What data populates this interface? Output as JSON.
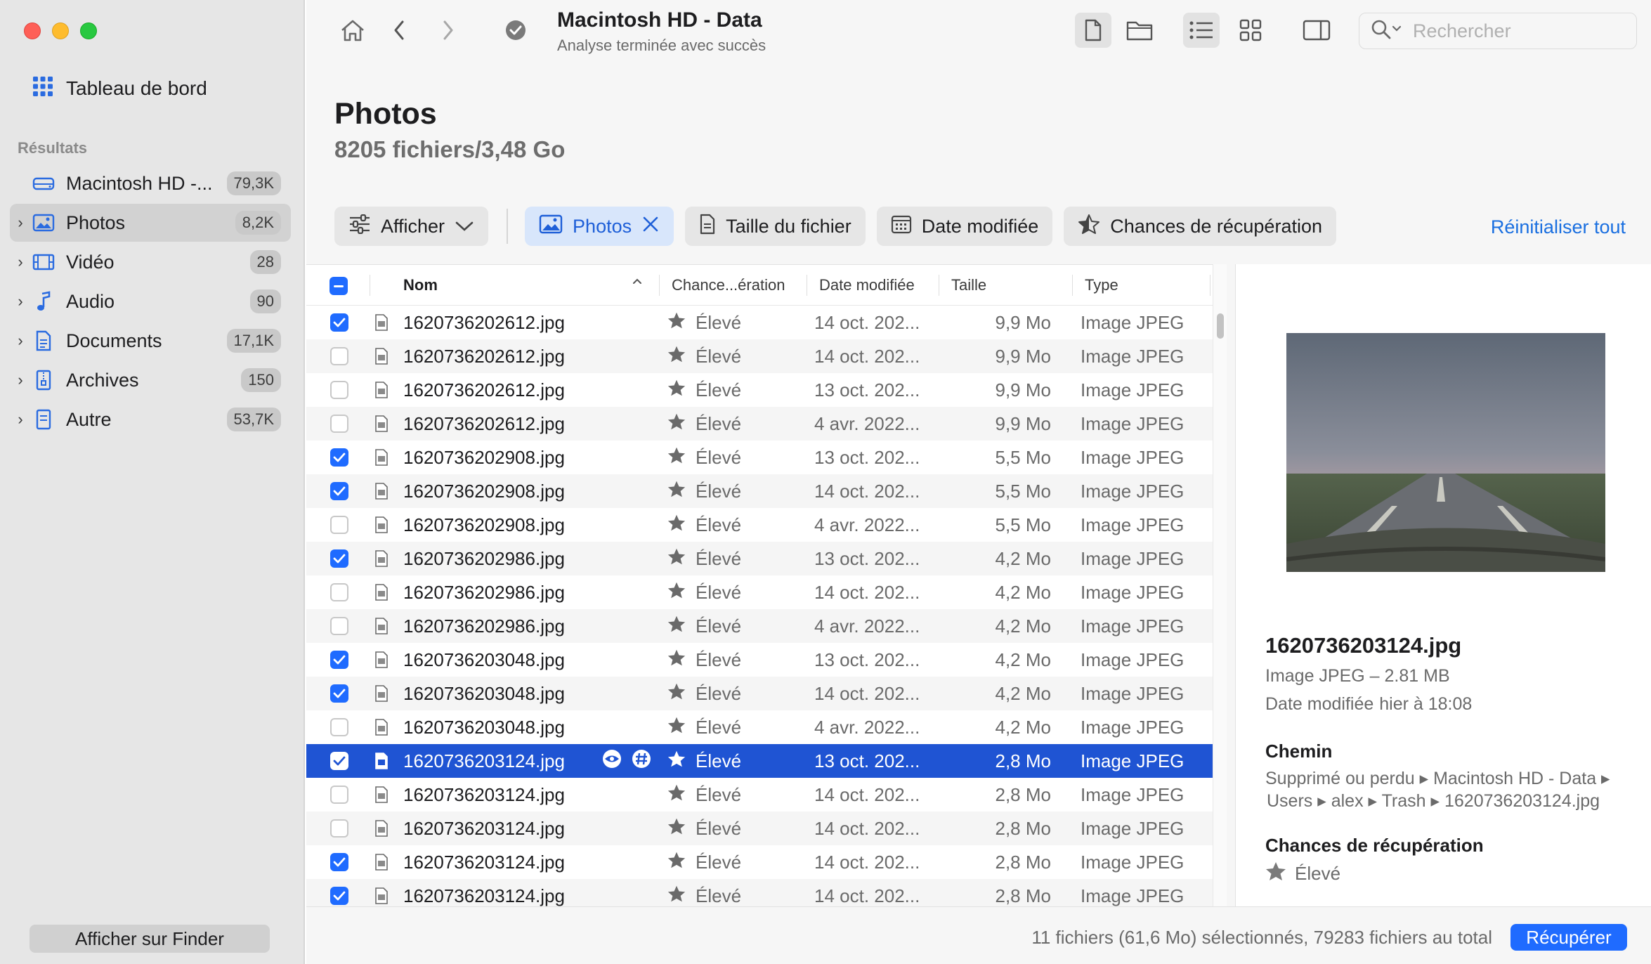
{
  "window": {
    "title": "Macintosh HD - Data",
    "subtitle": "Analyse terminée avec succès"
  },
  "search": {
    "placeholder": "Rechercher"
  },
  "sidebar": {
    "dashboard": "Tableau de bord",
    "section": "Résultats",
    "items": [
      {
        "label": "Macintosh HD -...",
        "count": "79,3K",
        "icon": "drive-icon"
      },
      {
        "label": "Photos",
        "count": "8,2K",
        "icon": "photo-icon"
      },
      {
        "label": "Vidéo",
        "count": "28",
        "icon": "film-icon"
      },
      {
        "label": "Audio",
        "count": "90",
        "icon": "music-note-icon"
      },
      {
        "label": "Documents",
        "count": "17,1K",
        "icon": "document-icon"
      },
      {
        "label": "Archives",
        "count": "150",
        "icon": "archive-icon"
      },
      {
        "label": "Autre",
        "count": "53,7K",
        "icon": "other-file-icon"
      }
    ],
    "finder_button": "Afficher sur Finder"
  },
  "page": {
    "title": "Photos",
    "subtitle": "8205 fichiers/3,48 Go"
  },
  "filters": {
    "show": "Afficher",
    "photos": "Photos",
    "file_size": "Taille du fichier",
    "date_modified": "Date modifiée",
    "recovery_chances": "Chances de récupération",
    "reset_all": "Réinitialiser tout"
  },
  "table": {
    "columns": {
      "name": "Nom",
      "chance": "Chance...ération",
      "date": "Date modifiée",
      "size": "Taille",
      "type": "Type"
    },
    "rows": [
      {
        "checked": true,
        "name": "1620736202612.jpg",
        "chance": "Élevé",
        "date": "14 oct. 202...",
        "size": "9,9 Mo",
        "type": "Image JPEG"
      },
      {
        "checked": false,
        "name": "1620736202612.jpg",
        "chance": "Élevé",
        "date": "14 oct. 202...",
        "size": "9,9 Mo",
        "type": "Image JPEG"
      },
      {
        "checked": false,
        "name": "1620736202612.jpg",
        "chance": "Élevé",
        "date": "13 oct. 202...",
        "size": "9,9 Mo",
        "type": "Image JPEG"
      },
      {
        "checked": false,
        "name": "1620736202612.jpg",
        "chance": "Élevé",
        "date": "4 avr. 2022...",
        "size": "9,9 Mo",
        "type": "Image JPEG"
      },
      {
        "checked": true,
        "name": "1620736202908.jpg",
        "chance": "Élevé",
        "date": "13 oct. 202...",
        "size": "5,5 Mo",
        "type": "Image JPEG"
      },
      {
        "checked": true,
        "name": "1620736202908.jpg",
        "chance": "Élevé",
        "date": "14 oct. 202...",
        "size": "5,5 Mo",
        "type": "Image JPEG"
      },
      {
        "checked": false,
        "name": "1620736202908.jpg",
        "chance": "Élevé",
        "date": "4 avr. 2022...",
        "size": "5,5 Mo",
        "type": "Image JPEG"
      },
      {
        "checked": true,
        "name": "1620736202986.jpg",
        "chance": "Élevé",
        "date": "13 oct. 202...",
        "size": "4,2 Mo",
        "type": "Image JPEG"
      },
      {
        "checked": false,
        "name": "1620736202986.jpg",
        "chance": "Élevé",
        "date": "14 oct. 202...",
        "size": "4,2 Mo",
        "type": "Image JPEG"
      },
      {
        "checked": false,
        "name": "1620736202986.jpg",
        "chance": "Élevé",
        "date": "4 avr. 2022...",
        "size": "4,2 Mo",
        "type": "Image JPEG"
      },
      {
        "checked": true,
        "name": "1620736203048.jpg",
        "chance": "Élevé",
        "date": "13 oct. 202...",
        "size": "4,2 Mo",
        "type": "Image JPEG"
      },
      {
        "checked": true,
        "name": "1620736203048.jpg",
        "chance": "Élevé",
        "date": "14 oct. 202...",
        "size": "4,2 Mo",
        "type": "Image JPEG"
      },
      {
        "checked": false,
        "name": "1620736203048.jpg",
        "chance": "Élevé",
        "date": "4 avr. 2022...",
        "size": "4,2 Mo",
        "type": "Image JPEG"
      },
      {
        "checked": true,
        "name": "1620736203124.jpg",
        "chance": "Élevé",
        "date": "13 oct. 202...",
        "size": "2,8 Mo",
        "type": "Image JPEG",
        "selected": true
      },
      {
        "checked": false,
        "name": "1620736203124.jpg",
        "chance": "Élevé",
        "date": "14 oct. 202...",
        "size": "2,8 Mo",
        "type": "Image JPEG"
      },
      {
        "checked": false,
        "name": "1620736203124.jpg",
        "chance": "Élevé",
        "date": "14 oct. 202...",
        "size": "2,8 Mo",
        "type": "Image JPEG"
      },
      {
        "checked": true,
        "name": "1620736203124.jpg",
        "chance": "Élevé",
        "date": "14 oct. 202...",
        "size": "2,8 Mo",
        "type": "Image JPEG"
      },
      {
        "checked": true,
        "name": "1620736203124.jpg",
        "chance": "Élevé",
        "date": "14 oct. 202...",
        "size": "2,8 Mo",
        "type": "Image JPEG"
      }
    ]
  },
  "preview": {
    "filename": "1620736203124.jpg",
    "type_size": "Image JPEG – 2.81 MB",
    "date_label": "Date modifiée",
    "date_value": "hier à 18:08",
    "path_heading": "Chemin",
    "path_line1": "Supprimé ou perdu ▸ Macintosh HD - Data ▸",
    "path_line2": "Users ▸ alex ▸ Trash ▸ 1620736203124.jpg",
    "chance_heading": "Chances de récupération",
    "chance_value": "Élevé"
  },
  "status": {
    "summary": "11 fichiers (61,6 Mo) sélectionnés, 79283 fichiers au total",
    "recover_button": "Récupérer"
  },
  "colors": {
    "accent": "#1f6bff",
    "selected_row": "#1f54d3",
    "link": "#1a6fe0"
  }
}
